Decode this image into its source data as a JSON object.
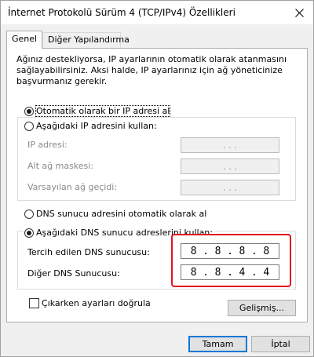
{
  "window": {
    "title": "İnternet Protokolü Sürüm 4 (TCP/IPv4) Özellikleri"
  },
  "tabs": [
    {
      "label": "Genel",
      "active": true
    },
    {
      "label": "Diğer Yapılandırma",
      "active": false
    }
  ],
  "description": "Ağınız destekliyorsa, IP ayarlarının otomatik olarak atanmasını sağlayabilirsiniz. Aksi halde, IP ayarlarınız için ağ yöneticinize başvurmanız gerekir.",
  "ip_section": {
    "auto_radio": {
      "label": "Otomatik olarak bir IP adresi al",
      "selected": true
    },
    "manual_radio": {
      "label": "Aşağıdaki IP adresini kullan:",
      "selected": false
    },
    "fields": [
      {
        "label": "IP adresi:",
        "value": ". . ."
      },
      {
        "label": "Alt ağ maskesi:",
        "value": ". . ."
      },
      {
        "label": "Varsayılan ağ geçidi:",
        "value": ". . ."
      }
    ]
  },
  "dns_section": {
    "auto_radio": {
      "label": "DNS sunucu adresini otomatik olarak al",
      "selected": false
    },
    "manual_radio": {
      "label": "Aşağıdaki DNS sunucu adreslerini kullan:",
      "selected": true
    },
    "preferred": {
      "label": "Tercih edilen DNS sunucusu:",
      "octets": [
        "8",
        "8",
        "8",
        "8"
      ]
    },
    "alternate": {
      "label": "Diğer DNS Sunucusu:",
      "octets": [
        "8",
        "8",
        "4",
        "4"
      ]
    }
  },
  "validate_checkbox": {
    "label": "Çıkarken ayarları doğrula",
    "checked": false
  },
  "buttons": {
    "advanced": "Gelişmiş...",
    "ok": "Tamam",
    "cancel": "İptal"
  },
  "colors": {
    "highlight": "#e1141e",
    "default_button_border": "#0078d7"
  }
}
